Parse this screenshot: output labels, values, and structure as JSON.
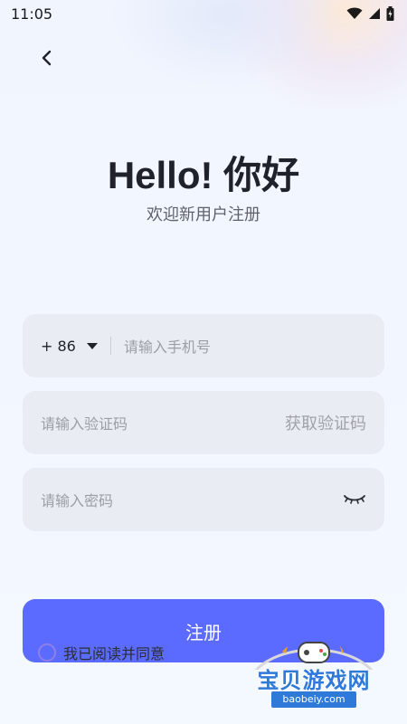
{
  "status_bar": {
    "time": "11:05",
    "icons": [
      "wifi-icon",
      "signal-icon",
      "battery-icon"
    ]
  },
  "nav": {
    "back_icon": "chevron-left-icon"
  },
  "header": {
    "title": "Hello! 你好",
    "subtitle": "欢迎新用户注册"
  },
  "form": {
    "country_code": "+ 86",
    "phone_placeholder": "请输入手机号",
    "code_placeholder": "请输入验证码",
    "get_code_label": "获取验证码",
    "password_placeholder": "请输入密码",
    "password_toggle_icon": "eye-closed-icon"
  },
  "actions": {
    "register_label": "注册",
    "agree_label": "我已阅读并同意",
    "agree_checked": false
  },
  "watermark": {
    "text": "宝贝游戏网",
    "url": "baobeiy.com"
  },
  "colors": {
    "accent": "#5b6bff",
    "field_bg": "#e9ecf2",
    "title": "#1f2229"
  }
}
